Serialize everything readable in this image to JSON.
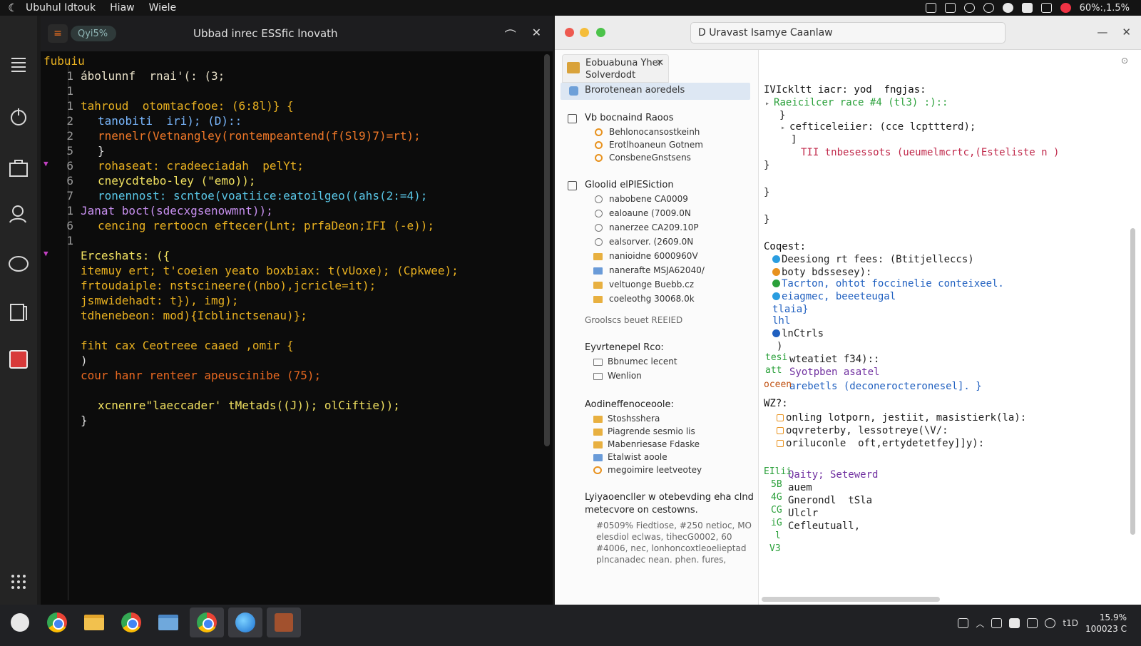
{
  "topbar": {
    "app_name": "Ubuhul Idtouk",
    "menu": [
      "Hiaw",
      "Wiele"
    ],
    "status": "60%:,1.5%"
  },
  "editor": {
    "tab_label": "Qyi5%",
    "title": "Ubbad inrec  ESSfic lnovath",
    "lines": [
      {
        "n": "",
        "text": "fubuiu",
        "color": "#e8b020",
        "indent": 0
      },
      {
        "n": "1",
        "text": "ábolunnf  rnai'(: (3;",
        "color": "#e8e0c8",
        "indent": 0
      },
      {
        "n": "1",
        "text": "",
        "color": "#ddd",
        "indent": 0
      },
      {
        "n": "1",
        "text": "tahroud  otomtacfooe: (6:8l)} {",
        "color": "#e8b020",
        "indent": 0
      },
      {
        "n": "2",
        "text": "tanobiti  iri); (D)::",
        "color": "#7ab8ff",
        "indent": 1
      },
      {
        "n": "2",
        "text": "rnenelr(Vetnangley(rontempeantend(f(Sl9)7)=rt);",
        "color": "#f07828",
        "indent": 1
      },
      {
        "n": "5",
        "text": "}",
        "color": "#ddd",
        "indent": 1
      },
      {
        "n": "6",
        "text": "rohaseat: cradeeciadah  pelYt;",
        "color": "#e8b020",
        "indent": 1
      },
      {
        "n": "6",
        "text": "cneycdtebo-ley (\"emo));",
        "color": "#f0e060",
        "indent": 1
      },
      {
        "n": "7",
        "text": "ronennost: scntoe(voatiice:eatoilgeo((ahs(2:=4);",
        "color": "#5ac8e8",
        "indent": 1
      },
      {
        "n": "1",
        "text": "Janat boct(sdecxgsenowmnt));",
        "color": "#c890f0",
        "indent": 0
      },
      {
        "n": "6",
        "text": "cencing rertoocn eftecer(Lnt; prfaDeon;IFI (-e));",
        "color": "#e8b020",
        "indent": 1
      },
      {
        "n": "1",
        "text": "",
        "color": "#ddd",
        "indent": 0
      },
      {
        "n": "",
        "text": "Erceshats: ({",
        "color": "#f0e060",
        "indent": 0
      },
      {
        "n": "",
        "text": "itemuy ert; t'coeien yeato boxbiax: t(vUoxe); (Cpkwee);",
        "color": "#e8b020",
        "indent": 0
      },
      {
        "n": "",
        "text": "frtoudaiple: nstscineere((nbo),jcricle=it);",
        "color": "#e8b020",
        "indent": 0
      },
      {
        "n": "",
        "text": "jsmwidehadt: t}), img);",
        "color": "#e8b020",
        "indent": 0
      },
      {
        "n": "",
        "text": "tdhenebeon: mod){Icblinctsenau)};",
        "color": "#e8b020",
        "indent": 0
      },
      {
        "n": "",
        "text": "",
        "color": "#ddd",
        "indent": 0
      },
      {
        "n": "",
        "text": "fiht cax Ceotreee caaed ,omir {",
        "color": "#e8b020",
        "indent": 0
      },
      {
        "n": "",
        "text": ")",
        "color": "#ddd",
        "indent": 0
      },
      {
        "n": "",
        "text": "cour hanr renteer apeuscinibe (75);",
        "color": "#e86820",
        "indent": 0
      },
      {
        "n": "",
        "text": "",
        "color": "#ddd",
        "indent": 0
      },
      {
        "n": "",
        "text": "xcnenre\"laeccader' tMetads((J)); olCiftie));",
        "color": "#f0e060",
        "indent": 1
      },
      {
        "n": "",
        "text": "}",
        "color": "#ddd",
        "indent": 0
      }
    ]
  },
  "browser": {
    "url": "D Uravast Isamye Caanlaw",
    "sidebar_tab": {
      "line1": "Eobuabuna Yher",
      "line2": "Solverdodt loraish"
    },
    "selected_item": "Brorotenean aoredels",
    "section1": {
      "title": "Vb bocnaind Raoos",
      "items": [
        "Behlonocansostkeinh",
        "Erotlhoaneun Gotnem",
        "ConsbeneGnstsens"
      ]
    },
    "section2": {
      "title": "Gloolid elPIESiction",
      "items": [
        {
          "label": "nabobene CA0009",
          "icon": "ring"
        },
        {
          "label": "ealoaune (7009.0N",
          "icon": "ring"
        },
        {
          "label": "nanerzee CA209.10P",
          "icon": "ring"
        },
        {
          "label": "ealsorver. (2609.0N",
          "icon": "ring"
        },
        {
          "label": "nanioidne 6000960V",
          "icon": "folder"
        },
        {
          "label": "nanerafte MSJA62040/",
          "icon": "folder-blue"
        },
        {
          "label": "veltuonge Buebb.cz",
          "icon": "folder"
        },
        {
          "label": "coeleothg 30068.0k",
          "icon": "folder"
        }
      ]
    },
    "link_label": "Groolscs beuet REEIED",
    "section3": {
      "title": "Eyvrtenepel Rco:",
      "items": [
        "Bbnumec lecent",
        "Wenlion"
      ]
    },
    "section4": {
      "title": "Aodineffenoceoole:",
      "items": [
        {
          "label": "Stoshsshera",
          "icon": "folder"
        },
        {
          "label": "Piagrende sesmio lis",
          "icon": "folder"
        },
        {
          "label": "Mabenriesase Fdaske",
          "icon": "folder"
        },
        {
          "label": "Etalwist aoole",
          "icon": "folder-blue"
        },
        {
          "label": "megoimire leetveotey",
          "icon": "heart"
        }
      ]
    },
    "section5": {
      "title_line1": "Lyiyaoencller w otebevding eha clnd",
      "title_line2": "metecvore on cestowns.",
      "body": [
        "#0509% Fiedtiose, #250 netioc, MO",
        "elesdiol eclwas, tihecG0002, 60",
        "#4006, nec, lonhoncoxtleoelieptad",
        "plncanadec  nean. phen. fures,"
      ]
    },
    "content": {
      "lines": [
        {
          "text": "IVIckltt iacr: yod  fngjas:",
          "color": "#111"
        },
        {
          "text": "Raeicilcer race #4 (tl3) :)::",
          "color": "#2aa03a"
        },
        {
          "text": "}",
          "color": "#222"
        },
        {
          "text": "cefticeleiier: (cce lcpttterd);",
          "color": "#222"
        },
        {
          "text": "]",
          "color": "#222"
        },
        {
          "text": "TII tnbesessots (ueumelmcrtc,(Esteliste n )",
          "color": "#c0284a"
        },
        {
          "text": "}",
          "color": "#222"
        },
        {
          "text": "}",
          "color": "#222"
        },
        {
          "text": "}",
          "color": "#222"
        },
        {
          "text": "Coqest:",
          "color": "#111"
        },
        {
          "text": "Deesiong rt fees: (Btitjelleccs)",
          "color": "#222"
        },
        {
          "text": "boty bdssesey):",
          "color": "#222"
        },
        {
          "text": "Tacrton, ohtot foccinelie conteixeel.",
          "color": "#2060c0"
        },
        {
          "text": "eiagmec, beeeteugal",
          "color": "#2060c0"
        },
        {
          "text": "tlaia}",
          "color": "#2060c0"
        },
        {
          "text": "lhl",
          "color": "#2060c0"
        },
        {
          "text": "lnCtrls",
          "color": "#222"
        },
        {
          "text": ")",
          "color": "#222"
        },
        {
          "text": "wteatiet f34)::",
          "color": "#222"
        },
        {
          "text": "Syotpben asatel",
          "color": "#7030a0"
        },
        {
          "text": "arebetls (deconerocteronesel]. }",
          "color": "#2060c0"
        },
        {
          "text": "WZ?:",
          "color": "#111"
        },
        {
          "text": "onling lotporn, jestiit, masistierk(la):",
          "color": "#222"
        },
        {
          "text": "oqvreterby, lessotreye(\\V/:",
          "color": "#222"
        },
        {
          "text": "oriluconle  oft,ertydetetfey]]y):",
          "color": "#222"
        },
        {
          "text": "Qaity; Setewerd",
          "color": "#7030a0"
        },
        {
          "text": "auem",
          "color": "#222"
        },
        {
          "text": "Gnerondl  tSla",
          "color": "#222"
        },
        {
          "text": "Ulclr",
          "color": "#222"
        },
        {
          "text": "Cefleutuall,",
          "color": "#222"
        }
      ],
      "gutter_labels": [
        "tesi",
        "att",
        "oceen",
        "EIlii",
        "5B",
        "4G",
        "CG",
        "iG",
        "l",
        "V3"
      ]
    }
  },
  "taskbar": {
    "time": "15.9%",
    "date": "100023 C",
    "lang": "t1D"
  }
}
